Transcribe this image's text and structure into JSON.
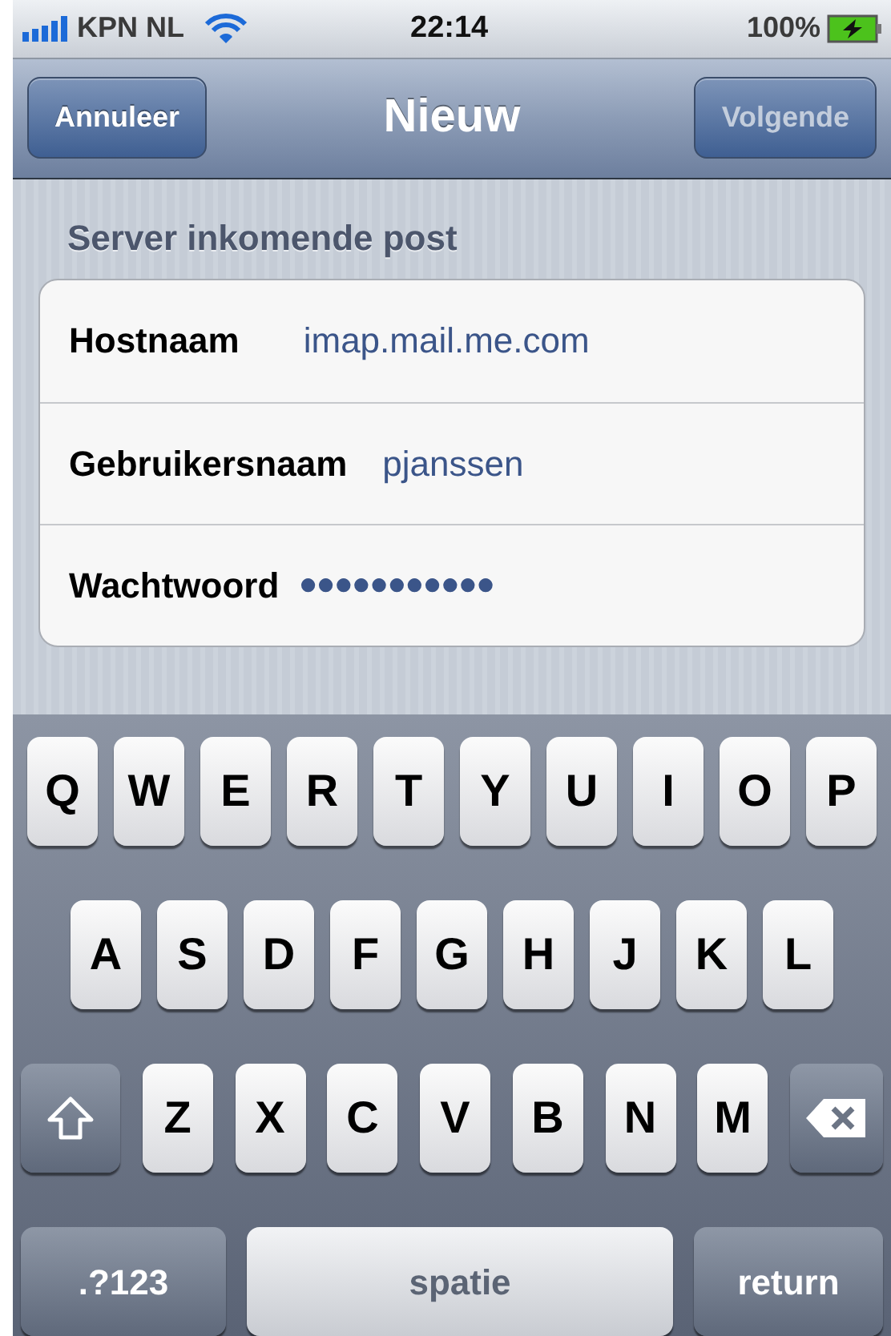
{
  "status_bar": {
    "carrier": "KPN NL",
    "time": "22:14",
    "battery": "100%"
  },
  "nav_bar": {
    "title": "Nieuw",
    "left_button": {
      "label": "Annuleer",
      "disabled": false
    },
    "right_button": {
      "label": "Volgende",
      "disabled": true
    }
  },
  "section": {
    "header": "Server inkomende post",
    "fields": [
      {
        "label": "Hostnaam",
        "value": "imap.mail.me.com",
        "kind": "text"
      },
      {
        "label": "Gebruikersnaam",
        "value": "pjanssen",
        "kind": "text"
      },
      {
        "label": "Wachtwoord",
        "value": "●●●●●●●●●●●",
        "kind": "password"
      }
    ]
  },
  "keyboard": {
    "rows": [
      [
        {
          "kind": "letter",
          "label": "Q"
        },
        {
          "kind": "letter",
          "label": "W"
        },
        {
          "kind": "letter",
          "label": "E"
        },
        {
          "kind": "letter",
          "label": "R"
        },
        {
          "kind": "letter",
          "label": "T"
        },
        {
          "kind": "letter",
          "label": "Y"
        },
        {
          "kind": "letter",
          "label": "U"
        },
        {
          "kind": "letter",
          "label": "I"
        },
        {
          "kind": "letter",
          "label": "O"
        },
        {
          "kind": "letter",
          "label": "P"
        }
      ],
      [
        {
          "kind": "letter",
          "label": "A"
        },
        {
          "kind": "letter",
          "label": "S"
        },
        {
          "kind": "letter",
          "label": "D"
        },
        {
          "kind": "letter",
          "label": "F"
        },
        {
          "kind": "letter",
          "label": "G"
        },
        {
          "kind": "letter",
          "label": "H"
        },
        {
          "kind": "letter",
          "label": "J"
        },
        {
          "kind": "letter",
          "label": "K"
        },
        {
          "kind": "letter",
          "label": "L"
        }
      ],
      [
        {
          "kind": "shift"
        },
        {
          "kind": "letter",
          "label": "Z"
        },
        {
          "kind": "letter",
          "label": "X"
        },
        {
          "kind": "letter",
          "label": "C"
        },
        {
          "kind": "letter",
          "label": "V"
        },
        {
          "kind": "letter",
          "label": "B"
        },
        {
          "kind": "letter",
          "label": "N"
        },
        {
          "kind": "letter",
          "label": "M"
        },
        {
          "kind": "delete"
        }
      ]
    ],
    "bottom_bar": {
      "numbers_key": ".?123",
      "space_key": "spatie",
      "return_key": "return"
    }
  }
}
